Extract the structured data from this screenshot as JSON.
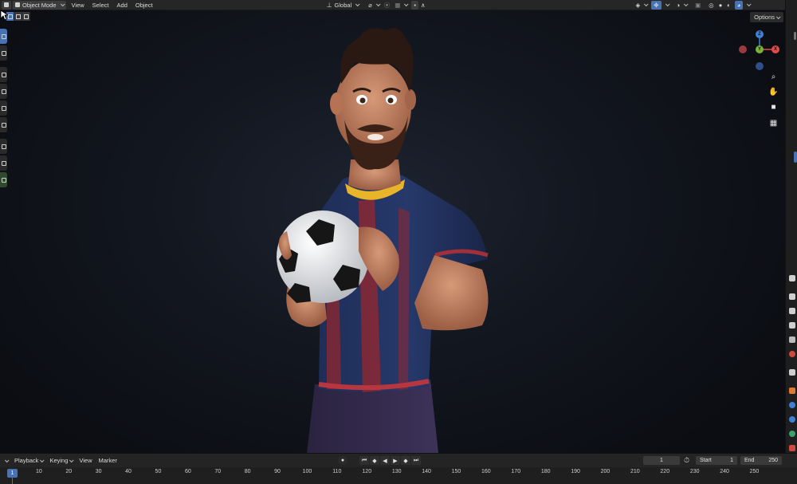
{
  "header": {
    "mode": "Object Mode",
    "menus": [
      "View",
      "Select",
      "Add",
      "Object"
    ],
    "transform_orientation": "Global",
    "options_label": "Options"
  },
  "gizmo": {
    "z": "Z",
    "x": "X",
    "y": "Y"
  },
  "timeline": {
    "menus": [
      "Playback",
      "Keying",
      "View",
      "Marker"
    ],
    "current_frame": "1",
    "start_label": "Start",
    "start_value": "1",
    "end_label": "End",
    "end_value": "250",
    "ruler_ticks": [
      "10",
      "20",
      "30",
      "40",
      "50",
      "60",
      "70",
      "80",
      "90",
      "100",
      "110",
      "120",
      "130",
      "140",
      "150",
      "160",
      "170",
      "180",
      "190",
      "200",
      "210",
      "220",
      "230",
      "240",
      "250"
    ],
    "playhead": "1"
  },
  "colors": {
    "accent": "#4772b3",
    "x_axis": "#e04b4b",
    "y_axis": "#7bb33a",
    "z_axis": "#3f7fd6"
  }
}
